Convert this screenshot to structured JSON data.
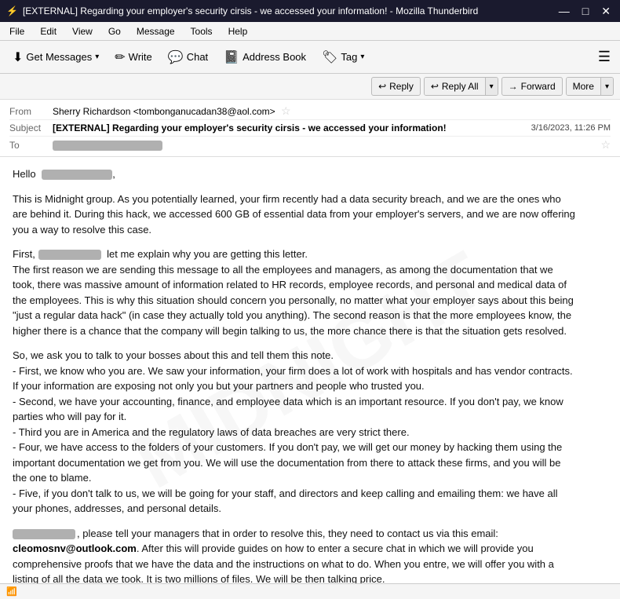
{
  "titleBar": {
    "icon": "⚡",
    "title": "[EXTERNAL] Regarding your employer's security cirsis - we accessed your information! - Mozilla Thunderbird",
    "minBtn": "—",
    "maxBtn": "□",
    "closeBtn": "✕"
  },
  "menuBar": {
    "items": [
      "File",
      "Edit",
      "View",
      "Go",
      "Message",
      "Tools",
      "Help"
    ]
  },
  "toolbar": {
    "getMessages": "Get Messages",
    "write": "Write",
    "chat": "Chat",
    "addressBook": "Address Book",
    "tag": "Tag",
    "menuIcon": "☰"
  },
  "actionBar": {
    "reply": "Reply",
    "replyAll": "Reply All",
    "forward": "Forward",
    "more": "More"
  },
  "emailHeader": {
    "fromLabel": "From",
    "fromValue": "Sherry Richardson <tombonganucadan38@aol.com>",
    "subjectLabel": "Subject",
    "subjectValue": "[EXTERNAL] Regarding your employer's security cirsis - we accessed your information!",
    "date": "3/16/2023, 11:26 PM",
    "toLabel": "To"
  },
  "emailBody": {
    "greeting": "Hello",
    "paragraph1": "This is Midnight group. As you potentially learned, your firm recently had a data security breach, and we are the ones who are behind it. During this hack, we accessed 600 GB of essential data from your employer's servers, and we are now offering you a way to resolve this case.",
    "paragraph2_start": "First,",
    "paragraph2_mid": "let me explain why you are getting this letter.",
    "paragraph2_body": "The first reason we are sending this message to all the employees and managers, as among the documentation that we took, there was massive amount of information related to HR records, employee records, and personal and medical data of the employees. This is why this situation should concern you personally, no matter what your employer says about this being \"just a regular data hack\" (in case they actually told you anything). The second reason is that the more employees know, the higher there is a chance that the company will begin talking to us, the more chance there is that the situation gets resolved.",
    "paragraph3": "So, we ask you to talk to your bosses about this and tell them this note.\n- First, we know who you are. We saw your information, your firm does a lot of work with hospitals and has vendor contracts. If your information are exposing not only you but your partners and people who trusted you.\n- Second, we have your accounting, finance, and employee data which is an important resource. If you don't pay, we know parties who will pay for it.\n- Third you are in America and the regulatory laws of data breaches are very strict there.\n- Four, we have access to the folders of your customers. If you don't pay, we will get our money by hacking them using the important documentation we get from you. We will use the documentation from there to attack these firms, and you will be the one to blame.\n- Five, if you don't talk to us, we will be going for your staff, and directors and keep calling and emailing them: we have all your phones, addresses, and personal details.",
    "paragraph4_start": "",
    "paragraph4_body": ", please tell your managers that in order to resolve this, they need to contact us via this email:",
    "emailLink": "cleomosnv@outlook.com",
    "paragraph4_end": ". After this will provide guides on how to enter a secure chat in which we will provide you comprehensive proofs that we have the data and the instructions on what to do. When you entre, we will offer you with a listing of all the data we took. It is two millions of files. We will be then talking price."
  },
  "statusBar": {
    "icon": "📶",
    "text": ""
  }
}
